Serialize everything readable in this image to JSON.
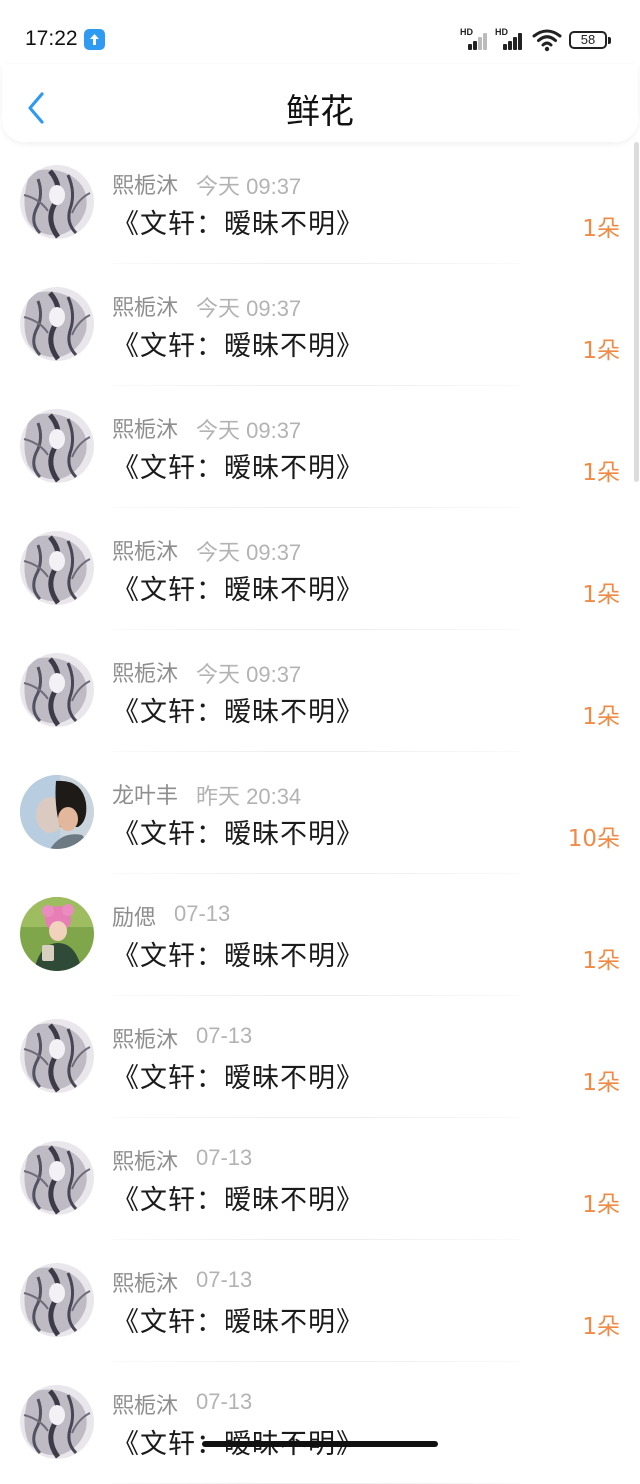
{
  "status": {
    "time": "17:22",
    "hd_label": "HD",
    "battery": "58",
    "upload_icon": "upload-arrow-icon"
  },
  "header": {
    "title": "鲜花",
    "back_icon": "chevron-left-icon"
  },
  "items": [
    {
      "name": "熙栀沐",
      "date": "今天 09:37",
      "work": "《文轩：暧昧不明》",
      "count": "1朵",
      "avatar": "grey-anime-avatar"
    },
    {
      "name": "熙栀沐",
      "date": "今天 09:37",
      "work": "《文轩：暧昧不明》",
      "count": "1朵",
      "avatar": "grey-anime-avatar"
    },
    {
      "name": "熙栀沐",
      "date": "今天 09:37",
      "work": "《文轩：暧昧不明》",
      "count": "1朵",
      "avatar": "grey-anime-avatar"
    },
    {
      "name": "熙栀沐",
      "date": "今天 09:37",
      "work": "《文轩：暧昧不明》",
      "count": "1朵",
      "avatar": "grey-anime-avatar"
    },
    {
      "name": "熙栀沐",
      "date": "今天 09:37",
      "work": "《文轩：暧昧不明》",
      "count": "1朵",
      "avatar": "grey-anime-avatar"
    },
    {
      "name": "龙叶丰",
      "date": "昨天 20:34",
      "work": "《文轩：暧昧不明》",
      "count": "10朵",
      "avatar": "blue-portrait-avatar"
    },
    {
      "name": "励偲",
      "date": "07-13",
      "work": "《文轩：暧昧不明》",
      "count": "1朵",
      "avatar": "green-photo-avatar"
    },
    {
      "name": "熙栀沐",
      "date": "07-13",
      "work": "《文轩：暧昧不明》",
      "count": "1朵",
      "avatar": "grey-anime-avatar"
    },
    {
      "name": "熙栀沐",
      "date": "07-13",
      "work": "《文轩：暧昧不明》",
      "count": "1朵",
      "avatar": "grey-anime-avatar"
    },
    {
      "name": "熙栀沐",
      "date": "07-13",
      "work": "《文轩：暧昧不明》",
      "count": "1朵",
      "avatar": "grey-anime-avatar"
    },
    {
      "name": "熙栀沐",
      "date": "07-13",
      "work": "《文轩：暧昧不明》",
      "count": "",
      "avatar": "grey-anime-avatar"
    }
  ],
  "colors": {
    "accent_blue": "#2f9af2",
    "flower_count": "#f08a45",
    "name_grey": "#8e8e8e",
    "date_grey": "#b3b3b3"
  }
}
